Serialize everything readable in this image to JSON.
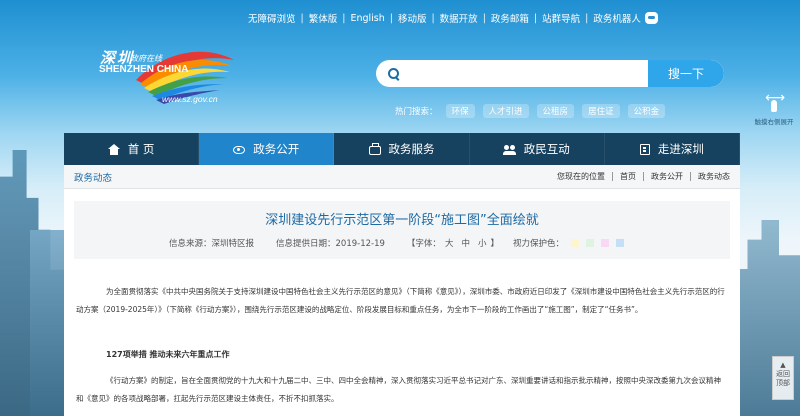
{
  "toplinks": [
    "无障碍浏览",
    "繁体版",
    "English",
    "移动版",
    "数据开放",
    "政务邮箱",
    "站群导航",
    "政务机器人"
  ],
  "logo": {
    "cn": "深圳",
    "cn_sub": "政府在线",
    "en": "SHENZHEN CHINA",
    "url": "www.sz.gov.cn"
  },
  "search": {
    "placeholder": "",
    "button": "搜一下"
  },
  "hot": {
    "label": "热门搜索：",
    "tags": [
      "环保",
      "人才引进",
      "公租房",
      "居住证",
      "公积金"
    ]
  },
  "side_touch": "触摸右侧展开",
  "nav": [
    {
      "label": "首 页",
      "icon": "home-icon",
      "active": false
    },
    {
      "label": "政务公开",
      "icon": "eye-icon",
      "active": true
    },
    {
      "label": "政务服务",
      "icon": "briefcase-icon",
      "active": false
    },
    {
      "label": "政民互动",
      "icon": "people-icon",
      "active": false
    },
    {
      "label": "走进深圳",
      "icon": "building-icon",
      "active": false
    }
  ],
  "crumbbar": {
    "title": "政务动态",
    "items": [
      "您现在的位置",
      "首页",
      "政务公开",
      "政务动态"
    ]
  },
  "article": {
    "title": "深圳建设先行示范区第一阶段“施工图”全面绘就",
    "source": "信息来源：深圳特区报",
    "date": "信息提供日期：2019-12-19",
    "font_label": "【字体：",
    "font_large": "大",
    "font_medium": "中",
    "font_small": "小",
    "font_end": "】",
    "vision_label": "视力保护色：",
    "swatch_colors": [
      "#fdf5cf",
      "#dff3e0",
      "#f8d8f2",
      "#c5dff7"
    ],
    "paragraphs": [
      "为全面贯彻落实《中共中央国务院关于支持深圳建设中国特色社会主义先行示范区的意见》（下简称《意见》），深圳市委、市政府近日印发了《深圳市建设中国特色社会主义先行示范区的行动方案（2019-2025年）》（下简称《行动方案》），围绕先行示范区建设的战略定位、阶段发展目标和重点任务，为全市下一阶段的工作画出了“施工图”，制定了“任务书”。",
      "127项举措 推动未来六年重点工作",
      "《行动方案》的制定，旨在全面贯彻党的十九大和十九届二中、三中、四中全会精神，深入贯彻落实习近平总书记对广东、深圳重要讲话和指示批示精神，按照中央深改委第九次会议精神和《意见》的各项战略部署，扛起先行示范区建设主体责任，不折不扣抓落实。"
    ]
  },
  "backtop": "返回顶部"
}
